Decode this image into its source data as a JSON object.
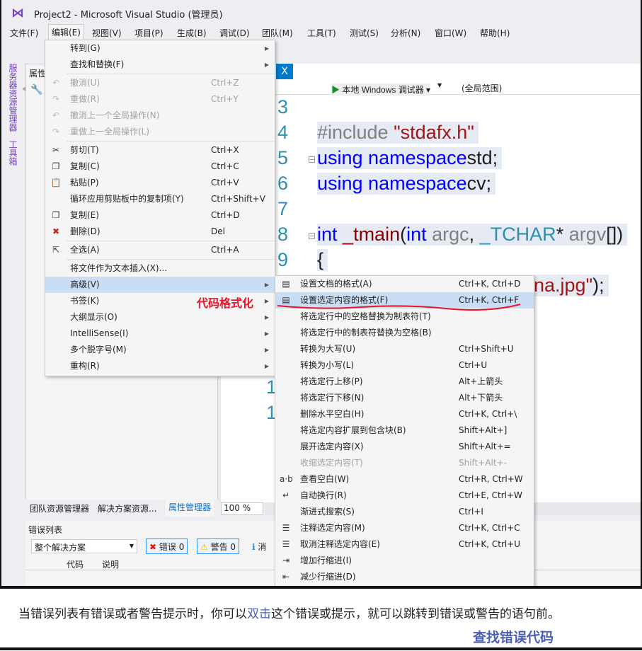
{
  "window": {
    "title": "Project2 - Microsoft Visual Studio (管理员)"
  },
  "menubar": [
    "文件(F)",
    "编辑(E)",
    "视图(V)",
    "项目(P)",
    "生成(B)",
    "调试(D)",
    "团队(M)",
    "工具(T)",
    "测试(S)",
    "分析(N)",
    "窗口(W)",
    "帮助(H)"
  ],
  "toolbar": {
    "run_label": "本地 Windows 调试器"
  },
  "left_tabs": [
    "服务器资源管理器",
    "工具箱"
  ],
  "properties": {
    "title": "属性"
  },
  "pane_tabs": [
    "团队资源管理器",
    "解决方案资源...",
    "属性管理器"
  ],
  "editor": {
    "tab_close": "X",
    "scope": "(全局范围)",
    "zoom": "100 %",
    "lines": [
      {
        "n": "3",
        "html": ""
      },
      {
        "n": "4",
        "parts": [
          [
            "pp",
            "#include "
          ],
          [
            "str",
            "\"stdafx.h\""
          ]
        ]
      },
      {
        "n": "5",
        "parts": [
          [
            "kw",
            "using namespace"
          ],
          [
            "",
            "std;"
          ]
        ]
      },
      {
        "n": "6",
        "parts": [
          [
            "kw",
            "using namespace"
          ],
          [
            "",
            "cv;"
          ]
        ]
      },
      {
        "n": "7",
        "parts": []
      },
      {
        "n": "8",
        "parts": [
          [
            "kw",
            "int"
          ],
          [
            "",
            " "
          ],
          [
            "fn",
            "_tmain"
          ],
          [
            "",
            "("
          ],
          [
            "kw",
            "int"
          ],
          [
            "par",
            " argc"
          ],
          [
            "",
            ", "
          ],
          [
            "ty",
            "_TCHAR"
          ],
          [
            "",
            "* "
          ],
          [
            "par",
            "argv"
          ],
          [
            "",
            "[])"
          ]
        ]
      },
      {
        "n": "9",
        "parts": [
          [
            "",
            "{"
          ]
        ]
      }
    ],
    "line10_tail": [
      [
        "str",
        "na.jpg\""
      ],
      [
        "",
        ");"
      ]
    ],
    "hidden_line_numbers": [
      "1",
      "1"
    ]
  },
  "edit_menu": [
    {
      "label": "转到(G)",
      "sub": true
    },
    {
      "label": "查找和替换(F)",
      "sub": true
    },
    {
      "sep": true
    },
    {
      "label": "撤消(U)",
      "shortcut": "Ctrl+Z",
      "icon": "undo-icon",
      "glyph": "↶",
      "disabled": true
    },
    {
      "label": "重做(R)",
      "shortcut": "Ctrl+Y",
      "icon": "redo-icon",
      "glyph": "↷",
      "disabled": true
    },
    {
      "label": "撤消上一个全局操作(N)",
      "icon": "undo-global-icon",
      "glyph": "↶",
      "disabled": true
    },
    {
      "label": "重做上一全局操作(L)",
      "icon": "redo-global-icon",
      "glyph": "↷",
      "disabled": true
    },
    {
      "sep": true
    },
    {
      "label": "剪切(T)",
      "shortcut": "Ctrl+X",
      "icon": "cut-icon",
      "glyph": "✂"
    },
    {
      "label": "复制(C)",
      "shortcut": "Ctrl+C",
      "icon": "copy-icon",
      "glyph": "❐"
    },
    {
      "label": "粘贴(P)",
      "shortcut": "Ctrl+V",
      "icon": "paste-icon",
      "glyph": "📋"
    },
    {
      "label": "循环应用剪贴板中的复制项(Y)",
      "shortcut": "Ctrl+Shift+V"
    },
    {
      "label": "复制(E)",
      "shortcut": "Ctrl+D",
      "icon": "duplicate-icon",
      "glyph": "❐"
    },
    {
      "label": "删除(D)",
      "shortcut": "Del",
      "icon": "delete-icon",
      "glyph": "✖",
      "color": "#c42b1c"
    },
    {
      "sep": true
    },
    {
      "label": "全选(A)",
      "shortcut": "Ctrl+A",
      "icon": "select-all-icon",
      "glyph": "⇱"
    },
    {
      "sep": true
    },
    {
      "label": "将文件作为文本插入(X)..."
    },
    {
      "label": "高级(V)",
      "sub": true,
      "highlight": true
    },
    {
      "label": "书签(K)",
      "sub": true
    },
    {
      "label": "大纲显示(O)",
      "sub": true
    },
    {
      "label": "IntelliSense(I)",
      "sub": true
    },
    {
      "label": "多个脱字号(M)",
      "sub": true
    },
    {
      "label": "重构(R)",
      "sub": true
    }
  ],
  "advanced_menu": [
    {
      "label": "设置文档的格式(A)",
      "shortcut": "Ctrl+K, Ctrl+D",
      "icon": "format-document-icon",
      "glyph": "▤"
    },
    {
      "label": "设置选定内容的格式(F)",
      "shortcut": "Ctrl+K, Ctrl+F",
      "icon": "format-selection-icon",
      "glyph": "▤",
      "highlight": true
    },
    {
      "label": "将选定行中的空格替换为制表符(T)"
    },
    {
      "label": "将选定行中的制表符替换为空格(B)"
    },
    {
      "label": "转换为大写(U)",
      "shortcut": "Ctrl+Shift+U"
    },
    {
      "label": "转换为小写(L)",
      "shortcut": "Ctrl+U"
    },
    {
      "label": "将选定行上移(P)",
      "shortcut": "Alt+上箭头"
    },
    {
      "label": "将选定行下移(N)",
      "shortcut": "Alt+下箭头"
    },
    {
      "label": "删除水平空白(H)",
      "shortcut": "Ctrl+K, Ctrl+\\"
    },
    {
      "label": "将选定内容扩展到包含块(B)",
      "shortcut": "Shift+Alt+]"
    },
    {
      "label": "展开选定内容(X)",
      "shortcut": "Shift+Alt+="
    },
    {
      "label": "收缩选定内容(T)",
      "shortcut": "Shift+Alt+-",
      "disabled": true
    },
    {
      "label": "查看空白(W)",
      "shortcut": "Ctrl+R, Ctrl+W",
      "icon": "view-whitespace-icon",
      "glyph": "a·b"
    },
    {
      "label": "自动换行(R)",
      "shortcut": "Ctrl+E, Ctrl+W",
      "icon": "word-wrap-icon",
      "glyph": "↵"
    },
    {
      "label": "渐进式搜索(S)",
      "shortcut": "Ctrl+I"
    },
    {
      "label": "注释选定内容(M)",
      "shortcut": "Ctrl+K, Ctrl+C",
      "icon": "comment-icon",
      "glyph": "☰"
    },
    {
      "label": "取消注释选定内容(E)",
      "shortcut": "Ctrl+K, Ctrl+U",
      "icon": "uncomment-icon",
      "glyph": "☰"
    },
    {
      "label": "增加行缩进(I)",
      "icon": "indent-icon",
      "glyph": "⇥"
    },
    {
      "label": "减少行缩进(D)",
      "icon": "outdent-icon",
      "glyph": "⇤"
    }
  ],
  "error_list": {
    "title": "错误列表",
    "scope": "整个解决方案",
    "errors": "错误 0",
    "warnings": "警告 0",
    "messages": "消",
    "col_code": "代码",
    "col_desc": "说明"
  },
  "annotation": {
    "label": "代码格式化",
    "color": "#e8132b"
  },
  "caption": {
    "before": "当错误列表有错误或者警告提示时，你可以",
    "highlight": "双击",
    "after": "这个错误或提示，就可以跳转到错误或警告的语句前。",
    "subtitle": "查找错误代码"
  }
}
